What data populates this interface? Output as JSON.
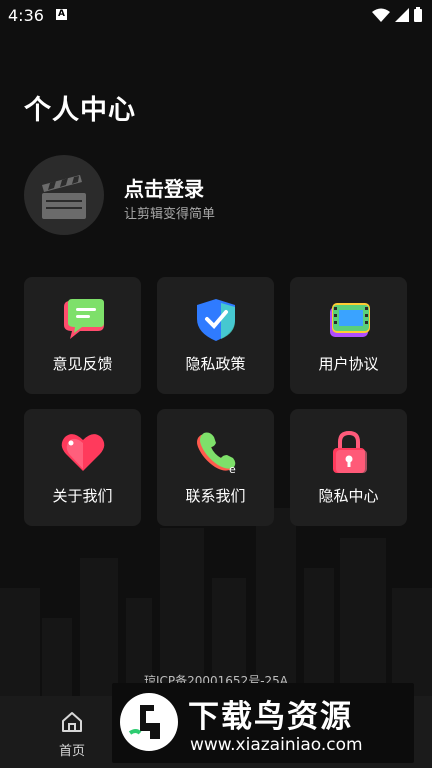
{
  "status": {
    "time": "4:36"
  },
  "page": {
    "title": "个人中心"
  },
  "profile": {
    "login_title": "点击登录",
    "login_subtitle": "让剪辑变得简单"
  },
  "menu": {
    "items": [
      {
        "label": "意见反馈",
        "icon": "feedback-chat-icon"
      },
      {
        "label": "隐私政策",
        "icon": "shield-check-icon"
      },
      {
        "label": "用户协议",
        "icon": "film-strip-icon"
      },
      {
        "label": "关于我们",
        "icon": "heart-icon"
      },
      {
        "label": "联系我们",
        "icon": "phone-icon"
      },
      {
        "label": "隐私中心",
        "icon": "lock-icon"
      }
    ]
  },
  "footer": {
    "icp": "琼ICP备20001652号-25A"
  },
  "bottom_nav": {
    "home_label": "首页"
  },
  "watermark": {
    "title": "下载鸟资源",
    "url": "www.xiazainiao.com"
  },
  "colors": {
    "background": "#0f0f0f",
    "card": "#1f1f1f",
    "accent_green": "#7ee06a",
    "accent_blue": "#2f7bff",
    "accent_pink": "#ff4d7a"
  }
}
